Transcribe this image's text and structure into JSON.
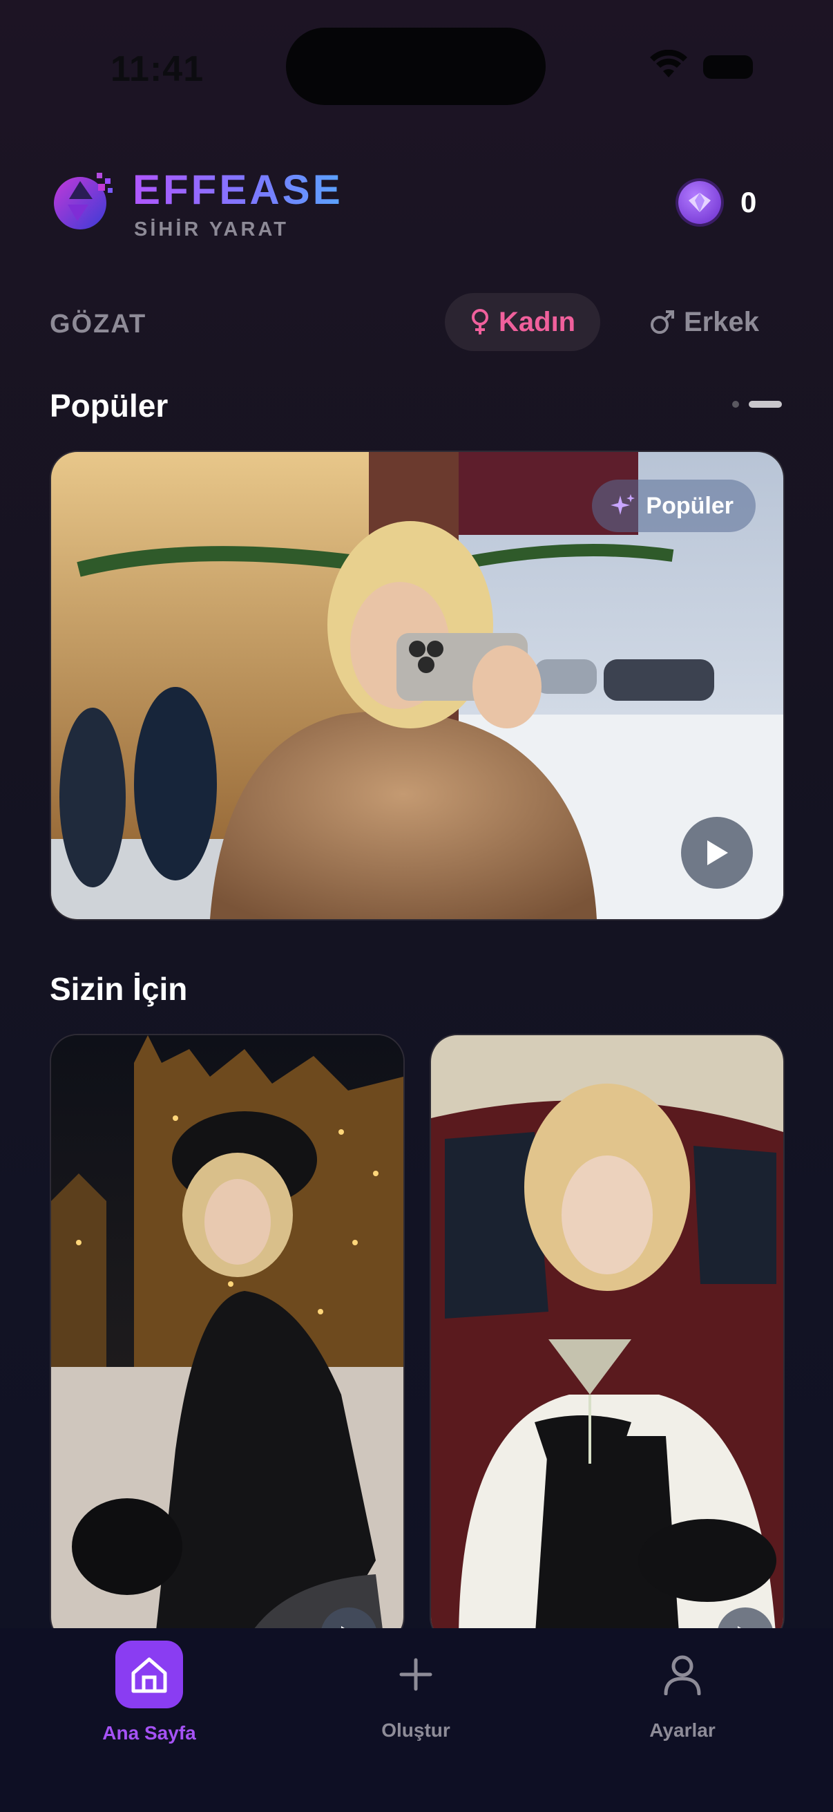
{
  "status_bar": {
    "time": "11:41"
  },
  "header": {
    "brand": "EFFEASE",
    "tagline": "SİHİR YARAT",
    "credits": "0",
    "logo_icon": "aperture-logo-icon",
    "gem_icon": "gem-icon"
  },
  "browse": {
    "label": "GÖZAT",
    "filters": [
      {
        "label": "Kadın",
        "icon": "female-icon",
        "selected": true
      },
      {
        "label": "Erkek",
        "icon": "male-icon",
        "selected": false
      }
    ]
  },
  "popular": {
    "title": "Popüler",
    "badge": "Popüler",
    "carousel_pages": 2,
    "active_page": 2
  },
  "for_you": {
    "title": "Sizin İçin"
  },
  "bottom_nav": {
    "items": [
      {
        "label": "Ana Sayfa",
        "icon": "home-icon",
        "active": true
      },
      {
        "label": "Oluştur",
        "icon": "plus-icon",
        "active": false
      },
      {
        "label": "Ayarlar",
        "icon": "user-icon",
        "active": false
      }
    ]
  },
  "colors": {
    "accent": "#8a3df2",
    "female_accent": "#f0609c",
    "muted": "#8e8b97",
    "background": "#151321"
  }
}
